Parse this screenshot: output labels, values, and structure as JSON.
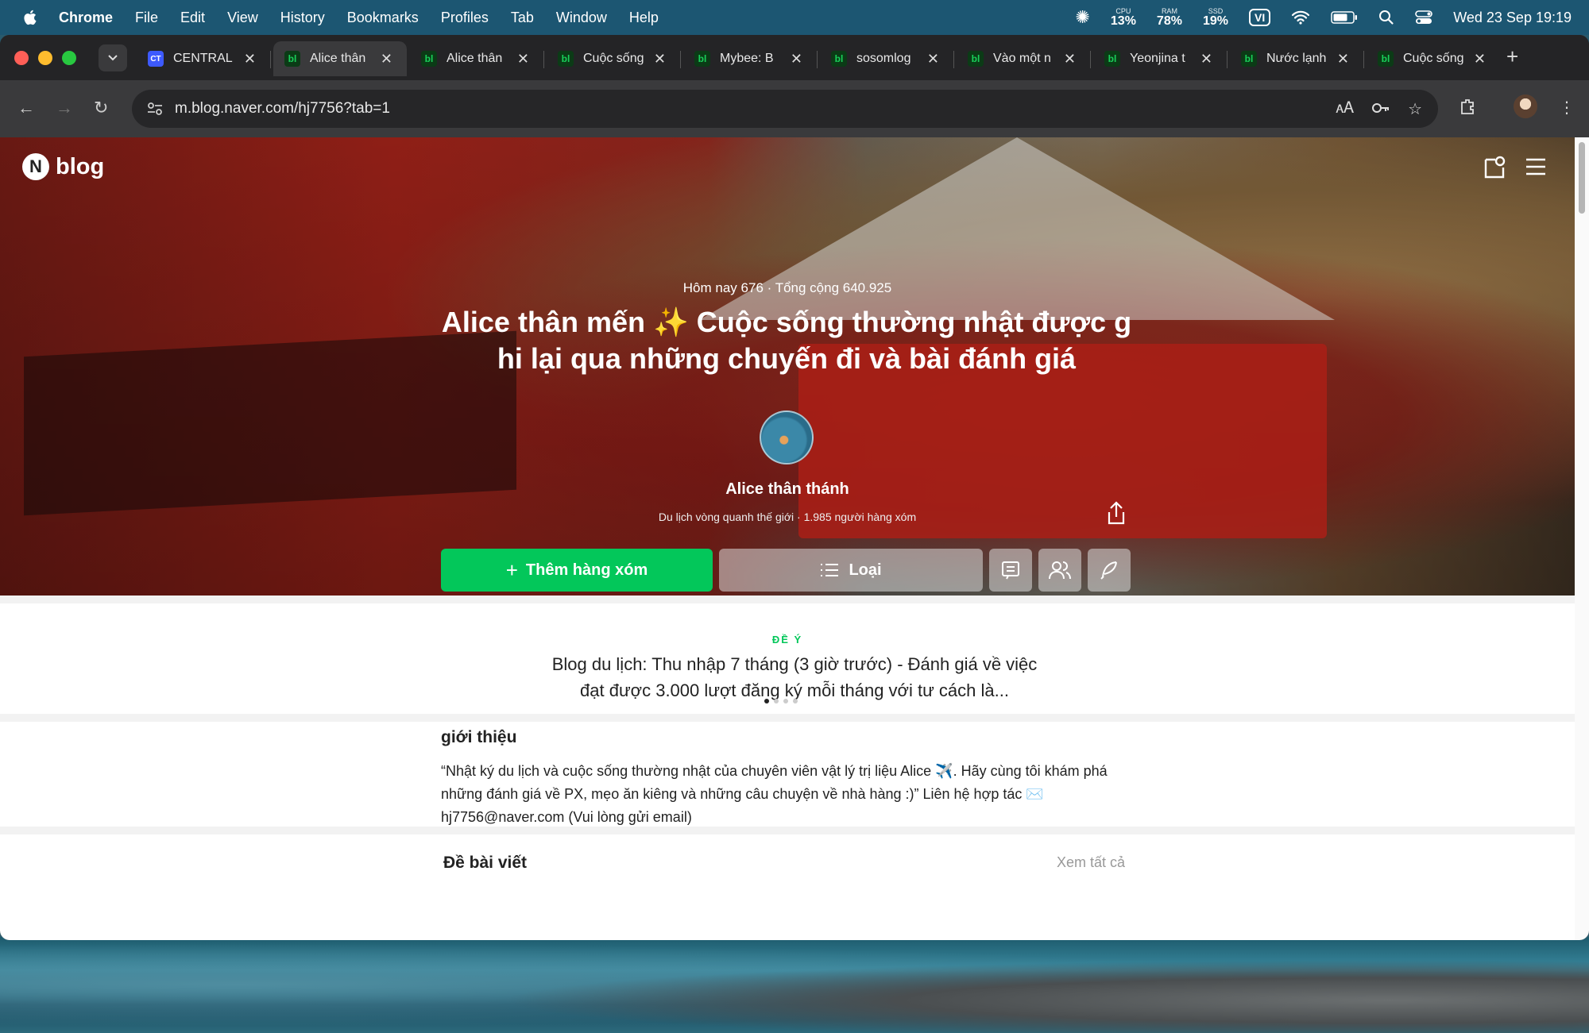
{
  "menubar": {
    "app": "Chrome",
    "items": [
      "File",
      "Edit",
      "View",
      "History",
      "Bookmarks",
      "Profiles",
      "Tab",
      "Window",
      "Help"
    ],
    "stats": [
      {
        "key": "CPU",
        "value": "13%"
      },
      {
        "key": "RAM",
        "value": "78%"
      },
      {
        "key": "SSD",
        "value": "19%"
      }
    ],
    "lang": "VI",
    "datetime": "Wed 23 Sep  19:19"
  },
  "tabs": [
    {
      "label": "CENTRAL",
      "favicon": "CT",
      "active": false
    },
    {
      "label": "Alice thân",
      "favicon": "bl",
      "active": true
    },
    {
      "label": "Alice thân",
      "favicon": "bl",
      "active": false
    },
    {
      "label": "Cuộc sống",
      "favicon": "bl",
      "active": false
    },
    {
      "label": "Mybee: B",
      "favicon": "bl",
      "active": false
    },
    {
      "label": "sosomlog",
      "favicon": "bl",
      "active": false
    },
    {
      "label": "Vào một n",
      "favicon": "bl",
      "active": false
    },
    {
      "label": "Yeonjina t",
      "favicon": "bl",
      "active": false
    },
    {
      "label": "Nước lạnh",
      "favicon": "bl",
      "active": false
    },
    {
      "label": "Cuộc sống",
      "favicon": "bl",
      "active": false
    }
  ],
  "address": {
    "url": "m.blog.naver.com/hj7756?tab=1"
  },
  "page": {
    "brand": "blog",
    "brand_n": "N",
    "visits": "Hôm nay 676 · Tổng cộng 640.925",
    "title": "Alice thân mến ✨ Cuộc sống thường nhật được ghi lại qua những chuyến đi và bài đánh giá",
    "nickname": "Alice thân thánh",
    "description": "Du lịch vòng quanh thế giới · 1.985 người hàng xóm",
    "add_neighbor": "Thêm hàng xóm",
    "category": "Loại",
    "recommend_label": "ĐỀ Ý",
    "recommend_title": "Blog du lịch: Thu nhập 7 tháng (3 giờ trước) - Đánh giá về việc đạt được 3.000 lượt đăng ký mỗi tháng với tư cách là...",
    "intro_heading": "giới thiệu",
    "intro_body": "“Nhật ký du lịch và cuộc sống thường nhật của chuyên viên vật lý trị liệu Alice ✈️. Hãy cùng tôi khám phá những đánh giá về PX, mẹo ăn kiêng và những câu chuyện về nhà hàng :)” Liên hệ hợp tác ✉️ hj7756@naver.com (Vui lòng gửi email)",
    "posts_heading": "Đề bài viết",
    "see_all": "Xem tất cả"
  },
  "colors": {
    "accent": "#03c75a",
    "menubar": "#1c5672"
  }
}
